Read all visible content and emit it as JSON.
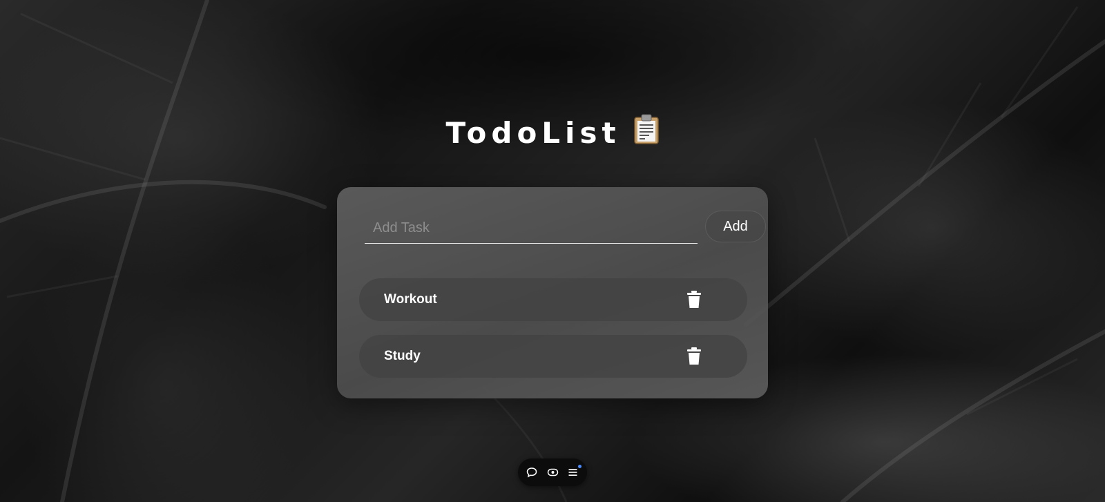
{
  "app": {
    "title": "TodoList",
    "title_icon": "clipboard-icon"
  },
  "add_task": {
    "placeholder": "Add Task",
    "value": "",
    "button_label": "Add"
  },
  "tasks": [
    {
      "label": "Workout",
      "action_icon": "trash-icon"
    },
    {
      "label": "Study",
      "action_icon": "trash-icon"
    }
  ],
  "toolbar": {
    "buttons": [
      {
        "icon": "comment-icon"
      },
      {
        "icon": "eye-icon"
      },
      {
        "icon": "menu-icon",
        "badge_color": "#4a8cff"
      }
    ]
  },
  "colors": {
    "text": "#ffffff",
    "card_bg": "#5a5a5a",
    "task_bg": "#424242",
    "placeholder": "#8e8e8e",
    "badge": "#4a8cff"
  }
}
